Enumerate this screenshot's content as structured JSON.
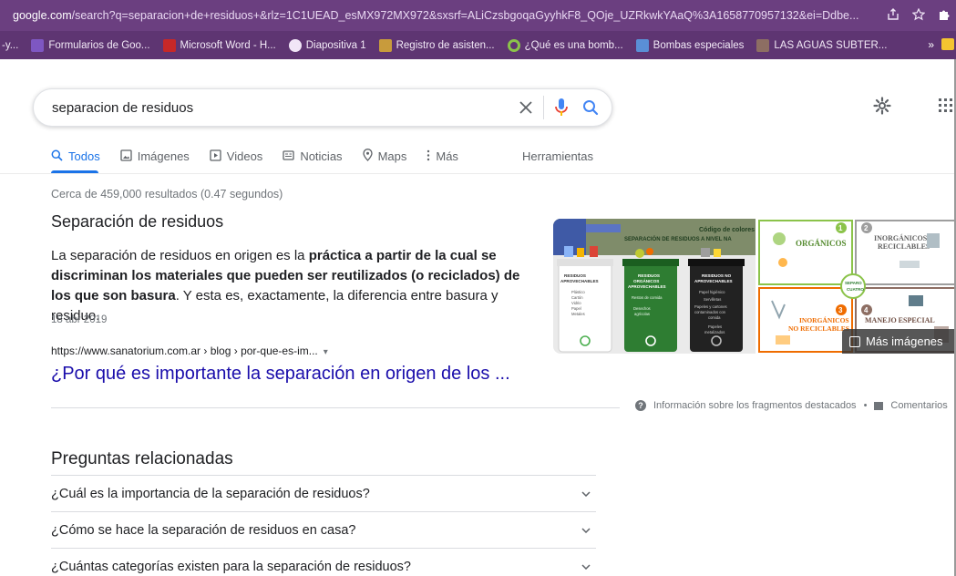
{
  "browser": {
    "url_domain": "google.com",
    "url_path": "/search?q=separacion+de+residuos+&rlz=1C1UEAD_esMX972MX972&sxsrf=ALiCzsbgoqaGyyhkF8_QOje_UZRkwkYAaQ%3A1658770957132&ei=Ddbe...",
    "bookmarks": [
      {
        "label": "-y...",
        "color": "#6b3f80"
      },
      {
        "label": "Formularios de Goo...",
        "color": "#7e57c2"
      },
      {
        "label": "Microsoft Word - H...",
        "color": "#c62828"
      },
      {
        "label": "Diapositiva 1",
        "color": "#3d3d3d"
      },
      {
        "label": "Registro de asisten...",
        "color": "#c89b3c"
      },
      {
        "label": "¿Qué es una bomb...",
        "color": "#8bc34a"
      },
      {
        "label": "Bombas especiales",
        "color": "#5a8fd6"
      },
      {
        "label": "LAS AGUAS SUBTER...",
        "color": "#8d6e63"
      }
    ],
    "bookmarks_more": "»"
  },
  "search": {
    "query": "separacion de residuos",
    "tabs": [
      {
        "label": "Todos",
        "icon": "search-icon"
      },
      {
        "label": "Imágenes",
        "icon": "image-icon"
      },
      {
        "label": "Videos",
        "icon": "video-icon"
      },
      {
        "label": "Noticias",
        "icon": "news-icon"
      },
      {
        "label": "Maps",
        "icon": "map-pin-icon"
      },
      {
        "label": "Más",
        "icon": "more-vert-icon"
      }
    ],
    "tools": "Herramientas",
    "result_count": "Cerca de 459,000 resultados (0.47 segundos)"
  },
  "featured_snippet": {
    "title": "Separación de residuos",
    "text_plain_1": "La separación de residuos en origen es la ",
    "text_bold": "práctica a partir de la cual se discriminan los materiales que pueden ser reutilizados (o reciclados) de los que son basura",
    "text_plain_2": ". Y esta es, exactamente, la diferencia entre basura y residuo.",
    "date": "18 abr 2019",
    "cite": "https://www.sanatorium.com.ar › blog › por-que-es-im...",
    "link": "¿Por qué es importante la separación en origen de los ...",
    "more_images": "Más imágenes",
    "img1": {
      "header": "SEPARACIÓN DE RESIDUOS A NIVEL NA",
      "header_top": "Código de colores",
      "bins": [
        {
          "title": "RESIDUOS APROVECHABLES",
          "items": "Plástico\nCartón\nVidrio\nPapel\nMetales",
          "color": "#ffffff",
          "text": "#333333"
        },
        {
          "title": "RESIDUOS ORGÁNICOS APROVECHABLES",
          "items": "Restos de comida\nDesechos agrícolas",
          "color": "#2e7d32",
          "text": "#ffffff"
        },
        {
          "title": "RESIDUOS NO APROVECHABLES",
          "items": "Papel higiénico\nServilletas\nPapeles y cartones contaminados con comida\nPapeles metalizados",
          "color": "#222222",
          "text": "#ffffff"
        }
      ]
    },
    "img2": {
      "q1": "ORGÁNICOS",
      "q2": "INORGÁNICOS RECICLABLES",
      "q3": "INORGÁNICOS NO RECICLABLES",
      "q4": "MANEJO ESPECIAL",
      "center": "SEPARO EN CUATRO"
    }
  },
  "feedback": {
    "info": "Información sobre los fragmentos destacados",
    "dot": "•",
    "comments": "Comentarios"
  },
  "related": {
    "title": "Preguntas relacionadas",
    "questions": [
      "¿Cuál es la importancia de la separación de residuos?",
      "¿Cómo se hace la separación de residuos en casa?",
      "¿Cuántas categorías existen para la separación de residuos?"
    ]
  },
  "colors": {
    "accent": "#1a73e8",
    "link": "#1a0dab",
    "chrome": "#6b3f80",
    "bookmarks_bar": "#5e3572"
  }
}
